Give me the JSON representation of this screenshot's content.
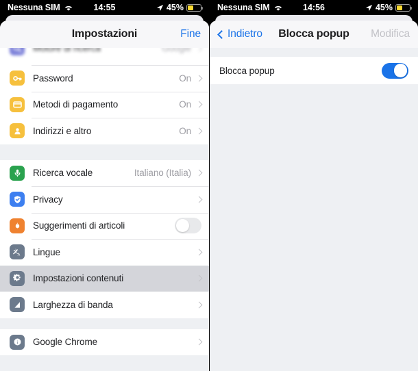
{
  "left": {
    "status_bar": {
      "carrier": "Nessuna SIM",
      "wifi_icon": "wifi-icon",
      "time": "14:55",
      "location_icon": "location-arrow-icon",
      "battery_percent": "45%",
      "battery_icon": "battery-low-power-icon"
    },
    "navbar": {
      "title": "Impostazioni",
      "right_action": "Fine"
    },
    "section1": [
      {
        "label": "Motore di ricerca",
        "value": "Google",
        "icon": "search-engine-icon",
        "icon_color": "#6a6fd4",
        "accessory": "chevron",
        "partial": true
      },
      {
        "label": "Password",
        "value": "On",
        "icon": "key-icon",
        "icon_color": "#f6c03d",
        "accessory": "chevron"
      },
      {
        "label": "Metodi di pagamento",
        "value": "On",
        "icon": "credit-card-icon",
        "icon_color": "#f6c03d",
        "accessory": "chevron"
      },
      {
        "label": "Indirizzi e altro",
        "value": "On",
        "icon": "person-icon",
        "icon_color": "#f6c03d",
        "accessory": "chevron"
      }
    ],
    "section2": [
      {
        "label": "Ricerca vocale",
        "value": "Italiano (Italia)",
        "icon": "microphone-icon",
        "icon_color": "#2aa24e",
        "accessory": "chevron"
      },
      {
        "label": "Privacy",
        "value": "",
        "icon": "shield-check-icon",
        "icon_color": "#3d7ff0",
        "accessory": "chevron"
      },
      {
        "label": "Suggerimenti di articoli",
        "value": "",
        "icon": "flame-icon",
        "icon_color": "#ef8230",
        "accessory": "toggle-off"
      },
      {
        "label": "Lingue",
        "value": "",
        "icon": "translate-icon",
        "icon_color": "#6c7a8c",
        "accessory": "chevron"
      },
      {
        "label": "Impostazioni contenuti",
        "value": "",
        "icon": "gear-icon",
        "icon_color": "#6c7a8c",
        "accessory": "chevron",
        "selected": true
      },
      {
        "label": "Larghezza di banda",
        "value": "",
        "icon": "bandwidth-icon",
        "icon_color": "#6c7a8c",
        "accessory": "chevron"
      }
    ],
    "section3": [
      {
        "label": "Google Chrome",
        "value": "",
        "icon": "info-icon",
        "icon_color": "#6c7a8c",
        "accessory": "chevron"
      }
    ]
  },
  "right": {
    "status_bar": {
      "carrier": "Nessuna SIM",
      "wifi_icon": "wifi-icon",
      "time": "14:56",
      "location_icon": "location-arrow-icon",
      "battery_percent": "45%",
      "battery_icon": "battery-low-power-icon"
    },
    "navbar": {
      "back_label": "Indietro",
      "title": "Blocca popup",
      "right_action": "Modifica",
      "right_action_disabled": true
    },
    "rows": [
      {
        "label": "Blocca popup",
        "accessory": "toggle-on"
      }
    ]
  },
  "colors": {
    "accent_blue": "#1a73e8",
    "toggle_on": "#1a73e8",
    "toggle_off": "#e8e9eb",
    "list_bg": "#eef0f3",
    "selected_row": "#d4d5da",
    "battery_yellow": "#f8d832"
  }
}
